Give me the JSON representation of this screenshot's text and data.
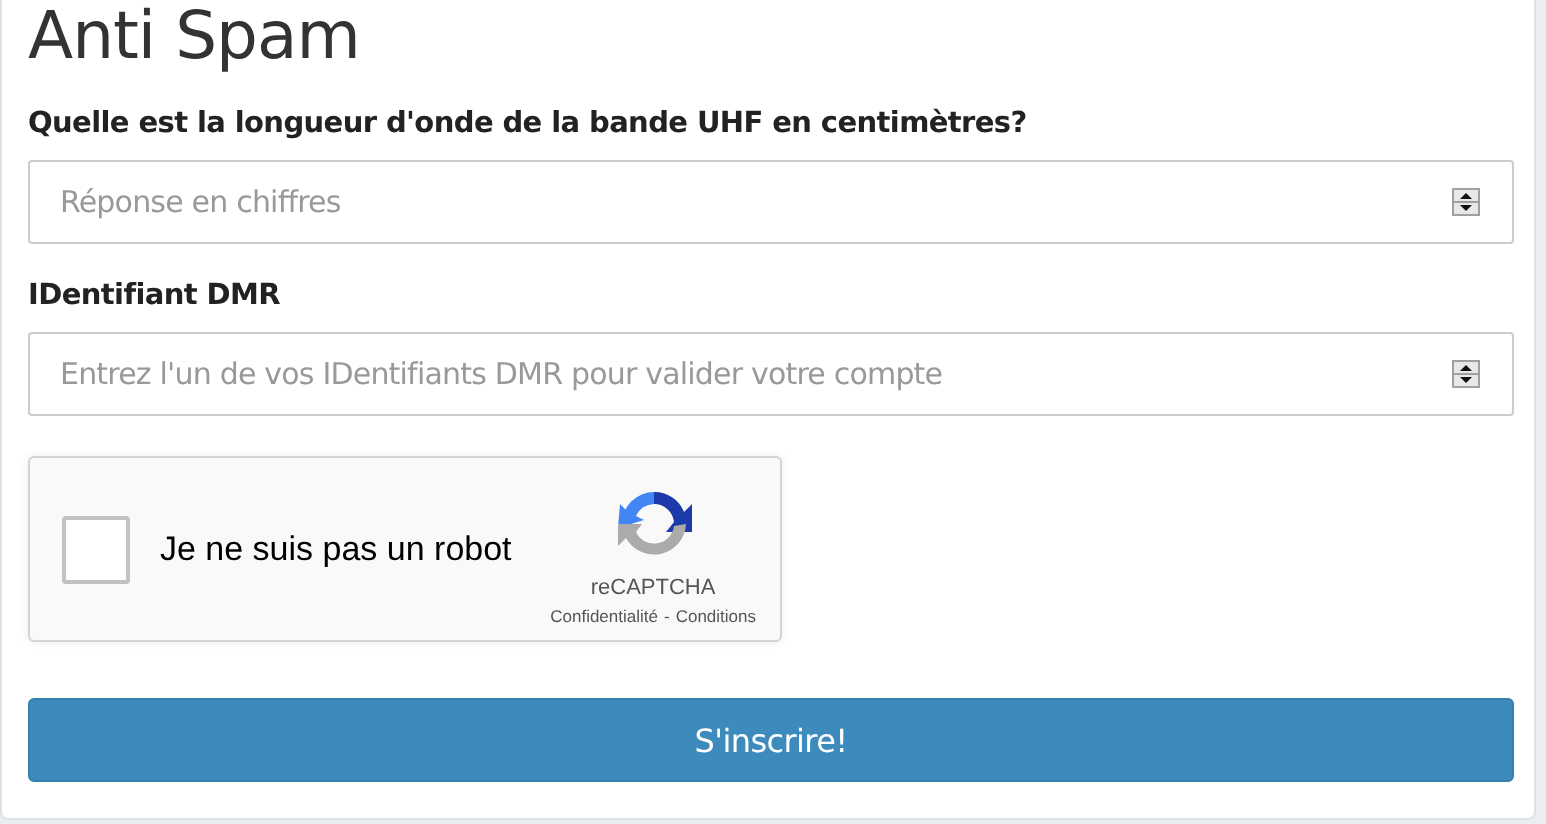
{
  "title": "Anti Spam",
  "fields": [
    {
      "label": "Quelle est la longueur d'onde de la bande UHF en centimètres?",
      "placeholder": "Réponse en chiffres"
    },
    {
      "label": "IDentifiant DMR",
      "placeholder": "Entrez l'un de vos IDentifiants DMR pour valider votre compte"
    }
  ],
  "captcha": {
    "checked": false,
    "label": "Je ne suis pas un robot",
    "brand": "reCAPTCHA",
    "links": [
      "Confidentialité",
      "Conditions"
    ],
    "separator": "-"
  },
  "submit": "S'inscrire!"
}
